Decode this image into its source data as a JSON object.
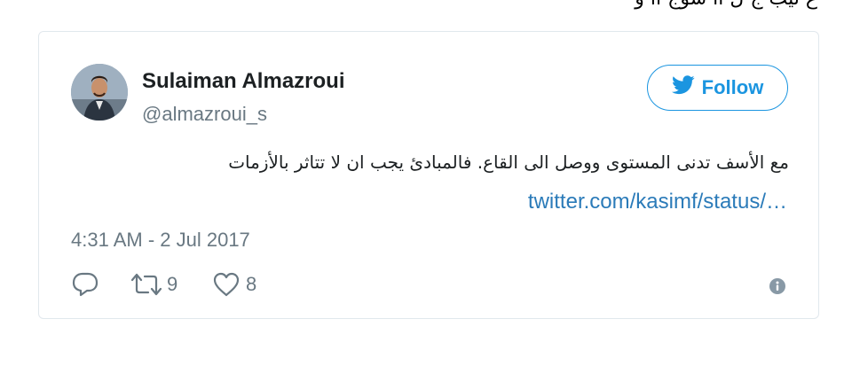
{
  "context": {
    "top_text": "ع تيب  ج ل  اا سوج اا و"
  },
  "tweet": {
    "user": {
      "name": "Sulaiman Almazroui",
      "handle": "@almazroui_s"
    },
    "follow_label": "Follow",
    "text": "مع الأسف تدنى المستوى ووصل الى القاع. فالمبادئ يجب ان لا تتاثر بالأزمات",
    "link": "twitter.com/kasimf/status/…",
    "timestamp": "4:31 AM - 2 Jul 2017",
    "actions": {
      "retweet_count": "9",
      "like_count": "8"
    }
  },
  "colors": {
    "accent": "#1b95e0",
    "link": "#2b7bb9",
    "muted": "#697882",
    "text": "#1c2022",
    "border": "#e1e8ed"
  },
  "icons": [
    "twitter-bird-icon",
    "reply-icon",
    "retweet-icon",
    "like-icon",
    "info-icon"
  ]
}
